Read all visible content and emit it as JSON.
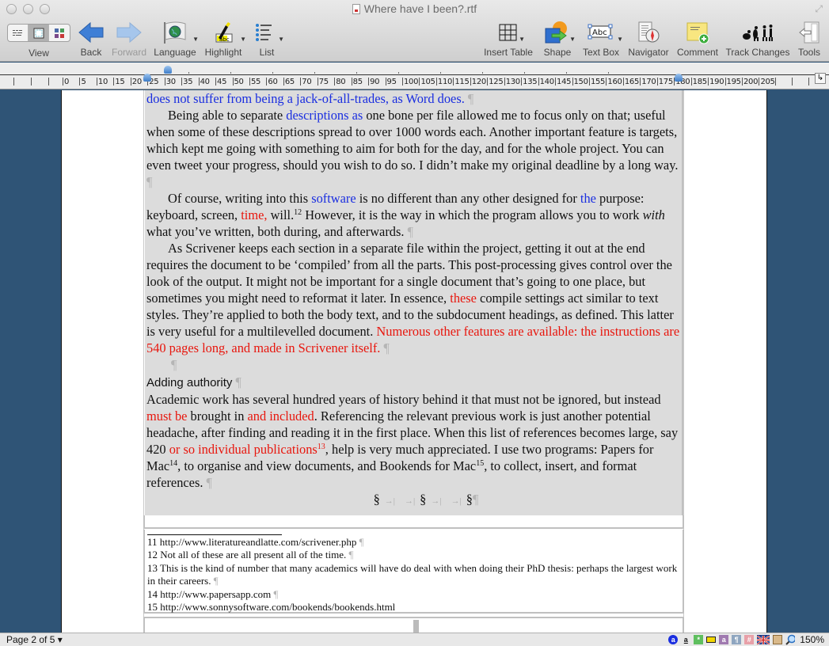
{
  "window": {
    "title": "Where have I been?.rtf"
  },
  "toolbar": {
    "left": [
      {
        "id": "view",
        "label": "View"
      },
      {
        "id": "back",
        "label": "Back"
      },
      {
        "id": "forward",
        "label": "Forward",
        "disabled": true
      },
      {
        "id": "language",
        "label": "Language"
      },
      {
        "id": "highlight",
        "label": "Highlight"
      },
      {
        "id": "list",
        "label": "List"
      }
    ],
    "right": [
      {
        "id": "insert-table",
        "label": "Insert Table"
      },
      {
        "id": "shape",
        "label": "Shape"
      },
      {
        "id": "text-box",
        "label": "Text Box"
      },
      {
        "id": "navigator",
        "label": "Navigator"
      },
      {
        "id": "comment",
        "label": "Comment"
      },
      {
        "id": "track-changes",
        "label": "Track Changes"
      },
      {
        "id": "tools",
        "label": "Tools"
      }
    ],
    "view_label": "View",
    "back_label": "Back",
    "forward_label": "Forward",
    "language_label": "Language",
    "highlight_label": "Highlight",
    "list_label": "List",
    "insert_table_label": "Insert Table",
    "shape_label": "Shape",
    "text_box_label": "Text Box",
    "navigator_label": "Navigator",
    "comment_label": "Comment",
    "track_changes_label": "Track Changes",
    "tools_label": "Tools",
    "textbox_icon_text": "Abc",
    "highlight_icon_text": "abc"
  },
  "ruler": {
    "labels": [
      "0",
      "5",
      "10",
      "15",
      "20",
      "25",
      "30",
      "35",
      "40",
      "45",
      "50",
      "55",
      "60",
      "65",
      "70",
      "75",
      "80",
      "85",
      "90",
      "95",
      "100",
      "105",
      "110",
      "115",
      "120",
      "125",
      "130",
      "135",
      "140",
      "145",
      "150",
      "155",
      "160",
      "165",
      "170",
      "175",
      "180",
      "185",
      "190",
      "195",
      "200",
      "205"
    ],
    "corner_glyph": "↳"
  },
  "document": {
    "line0": {
      "text": "does not suffer from being a jack-of-all-trades, as Word does.",
      "color": "blue"
    },
    "p1": {
      "a": "Being able to separate ",
      "b_blue": "descriptions as",
      "c": " one bone per file allowed me to focus only on that; useful when some of these descriptions spread to over 1000 words each. Another important feature is targets, which kept me going with something to aim for both for the day, and for the whole project. You can even tweet your progress, should you wish to do so. I didn’t make my original deadline by a long way."
    },
    "p2": {
      "a": "Of course, writing into this ",
      "b_blue": "software",
      "c": " is no different than any other designed for ",
      "d_blue": "the",
      "e": " purpose: keyboard, screen, ",
      "f_red": "time,",
      "g": " will.",
      "fn": "12",
      "h": " However, it is the way in which the program allows you to work ",
      "i_italic": "with",
      "j": " what you’ve written, both during, and afterwards."
    },
    "p3": {
      "a": "As Scrivener keeps each section in a separate file within the project, getting it out at the end requires the document to be ‘compiled’ from all the parts. This post-processing gives control over the look of the output. It might not be important for a single document that’s going to one place, but sometimes you might need to reformat it later. In essence, ",
      "b_red": "these",
      "c": " compile settings act similar to text styles. They’re applied to both the body text, and to the subdocument headings, as defined. This latter is very useful for a multilevelled document. ",
      "d_red": "Numerous other features are available: the instructions are 540 pages long, and made in Scrivener itself."
    },
    "heading": "Adding authority",
    "p4": {
      "a": "Academic work has several hundred years of history behind it that must not be ignored, but instead ",
      "b_red": "must be",
      "c": " brought in ",
      "d_red": "and included",
      "e": ". Referencing the relevant previous work is just another potential headache, after finding and reading it in the first place. When this list of references becomes large, say 420 ",
      "f_red": "or so individual publications",
      "fn13": "13",
      "g": ", help is very much appreciated. I use two programs: Papers for Mac",
      "fn14": "14",
      "h": ", to organise and view documents, and Bookends for Mac",
      "fn15": "15",
      "i": ", to collect, insert, and format references."
    },
    "pilcrow": "¶",
    "section_mark": "§",
    "tab_mark": "→|"
  },
  "footnotes": [
    {
      "num": "11",
      "text": "http://www.literatureandlatte.com/scrivener.php",
      "pilcrow": true
    },
    {
      "num": "12",
      "text": "Not all of these are all present all of the time.",
      "pilcrow": true
    },
    {
      "num": "13",
      "text": "This is the kind of number that many academics will have do deal with when doing their PhD thesis: perhaps the largest work in their careers.",
      "pilcrow": true
    },
    {
      "num": "14",
      "text": "http://www.papersapp.com",
      "pilcrow": true
    },
    {
      "num": "15",
      "text": "http://www.sonnysoftware.com/bookends/bookends.html",
      "pilcrow": false
    }
  ],
  "statusbar": {
    "page_indicator": "Page 2 of 5",
    "page_caret": "▾",
    "zoom": "150%",
    "icons": [
      "blue-circle-a-icon",
      "underline-a-icon",
      "green-asterisk-icon",
      "ruler-icon",
      "purple-a-icon",
      "paragraph-icon",
      "grid-icon",
      "uk-flag-icon",
      "clipboard-icon",
      "magnifier-icon"
    ]
  },
  "colors": {
    "desktop_bg": "#2f5476",
    "highlight_gray": "#dcdcdc",
    "blue_text": "#1a2ee0",
    "red_text": "#e8160d"
  }
}
